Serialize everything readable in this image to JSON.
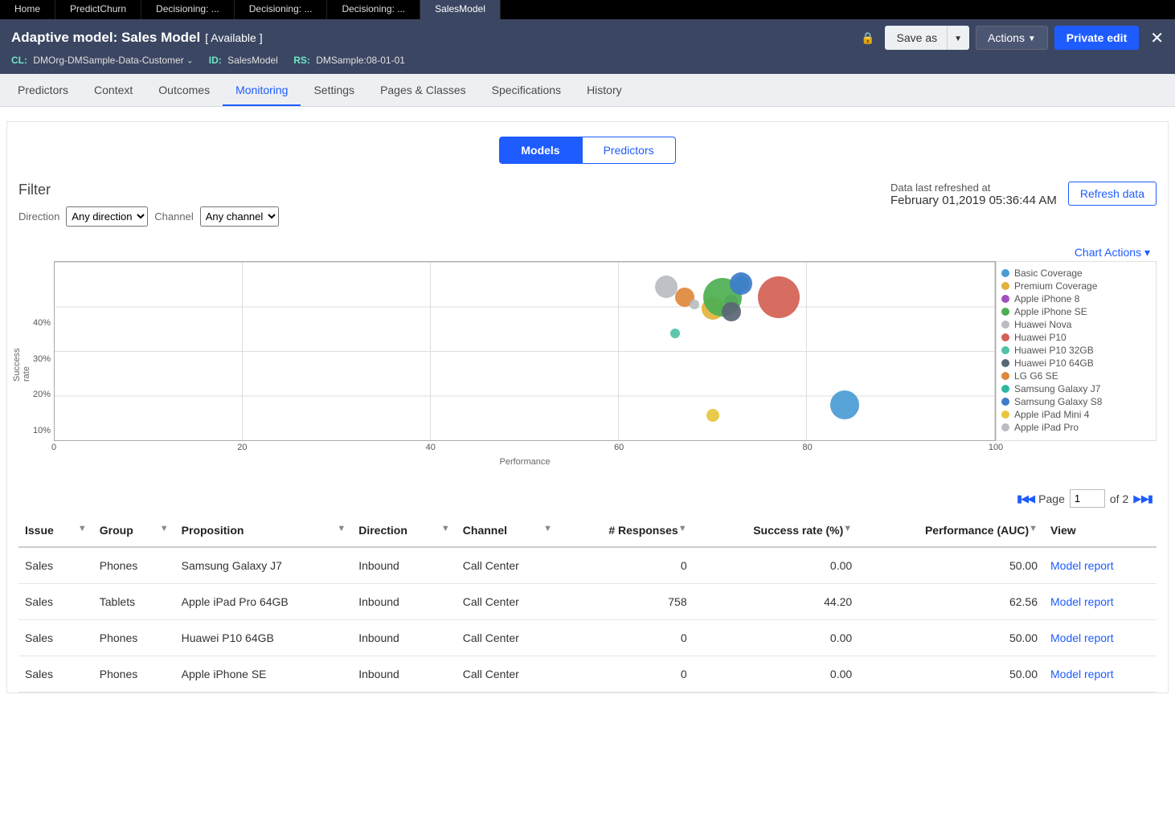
{
  "app_tabs": [
    "Home",
    "PredictChurn",
    "Decisioning: ...",
    "Decisioning: ...",
    "Decisioning: ...",
    "SalesModel"
  ],
  "app_tab_active": 5,
  "header": {
    "title": "Adaptive model: Sales Model",
    "status": "[ Available ]",
    "cl_key": "CL:",
    "cl_val": "DMOrg-DMSample-Data-Customer",
    "id_key": "ID:",
    "id_val": "SalesModel",
    "rs_key": "RS:",
    "rs_val": "DMSample:08-01-01",
    "save_as": "Save as",
    "actions": "Actions",
    "private_edit": "Private edit"
  },
  "page_nav": [
    "Predictors",
    "Context",
    "Outcomes",
    "Monitoring",
    "Settings",
    "Pages & Classes",
    "Specifications",
    "History"
  ],
  "page_nav_active": 3,
  "seg": {
    "models": "Models",
    "predictors": "Predictors"
  },
  "filter": {
    "title": "Filter",
    "direction_label": "Direction",
    "direction_value": "Any direction",
    "channel_label": "Channel",
    "channel_value": "Any channel"
  },
  "refresh": {
    "label": "Data last refreshed at",
    "timestamp": "February 01,2019 05:36:44 AM",
    "button": "Refresh data"
  },
  "chart_actions": "Chart Actions",
  "chart_data": {
    "type": "scatter",
    "xlabel": "Performance",
    "ylabel": "Success rate",
    "xlim": [
      0,
      100
    ],
    "ylim": [
      0,
      50
    ],
    "xticks": [
      0,
      20,
      40,
      60,
      80,
      100
    ],
    "yticks": [
      10,
      20,
      30,
      40
    ],
    "series": [
      {
        "name": "Basic Coverage",
        "color": "#4a9bd4",
        "x": 84,
        "y": 10,
        "r": 18
      },
      {
        "name": "Premium Coverage",
        "color": "#e3b23c",
        "x": 70,
        "y": 37,
        "r": 14
      },
      {
        "name": "Apple iPhone 8",
        "color": "#a24fbf",
        "x": 72,
        "y": 39,
        "r": 8
      },
      {
        "name": "Apple iPhone SE",
        "color": "#4caf50",
        "x": 71,
        "y": 40,
        "r": 24
      },
      {
        "name": "Huawei Nova",
        "color": "#b9bcc0",
        "x": 65,
        "y": 43,
        "r": 14
      },
      {
        "name": "Huawei P10",
        "color": "#d45f54",
        "x": 77,
        "y": 40,
        "r": 26
      },
      {
        "name": "Huawei P10 32GB",
        "color": "#4fc1a6",
        "x": 66,
        "y": 30,
        "r": 6
      },
      {
        "name": "Huawei P10 64GB",
        "color": "#596675",
        "x": 72,
        "y": 36,
        "r": 12
      },
      {
        "name": "LG G6 SE",
        "color": "#e0883c",
        "x": 67,
        "y": 40,
        "r": 12
      },
      {
        "name": "Samsung Galaxy J7",
        "color": "#2fb8a0",
        "x": 73,
        "y": 44,
        "r": 10
      },
      {
        "name": "Samsung Galaxy S8",
        "color": "#3d7cc9",
        "x": 73,
        "y": 44,
        "r": 14
      },
      {
        "name": "Apple iPad Mini 4",
        "color": "#e8c63c",
        "x": 70,
        "y": 7,
        "r": 8
      },
      {
        "name": "Apple iPad Pro",
        "color": "#b9bcc0",
        "x": 68,
        "y": 38,
        "r": 6
      }
    ]
  },
  "pager": {
    "label": "Page",
    "current": "1",
    "of": "of 2"
  },
  "table": {
    "headers": [
      "Issue",
      "Group",
      "Proposition",
      "Direction",
      "Channel",
      "# Responses",
      "Success rate (%)",
      "Performance (AUC)",
      "View"
    ],
    "rows": [
      {
        "issue": "Sales",
        "group": "Phones",
        "prop": "Samsung Galaxy J7",
        "dir": "Inbound",
        "chan": "Call Center",
        "resp": "0",
        "sr": "0.00",
        "perf": "50.00",
        "view": "Model report"
      },
      {
        "issue": "Sales",
        "group": "Tablets",
        "prop": "Apple iPad Pro 64GB",
        "dir": "Inbound",
        "chan": "Call Center",
        "resp": "758",
        "sr": "44.20",
        "perf": "62.56",
        "view": "Model report"
      },
      {
        "issue": "Sales",
        "group": "Phones",
        "prop": "Huawei P10 64GB",
        "dir": "Inbound",
        "chan": "Call Center",
        "resp": "0",
        "sr": "0.00",
        "perf": "50.00",
        "view": "Model report"
      },
      {
        "issue": "Sales",
        "group": "Phones",
        "prop": "Apple iPhone SE",
        "dir": "Inbound",
        "chan": "Call Center",
        "resp": "0",
        "sr": "0.00",
        "perf": "50.00",
        "view": "Model report"
      }
    ]
  }
}
